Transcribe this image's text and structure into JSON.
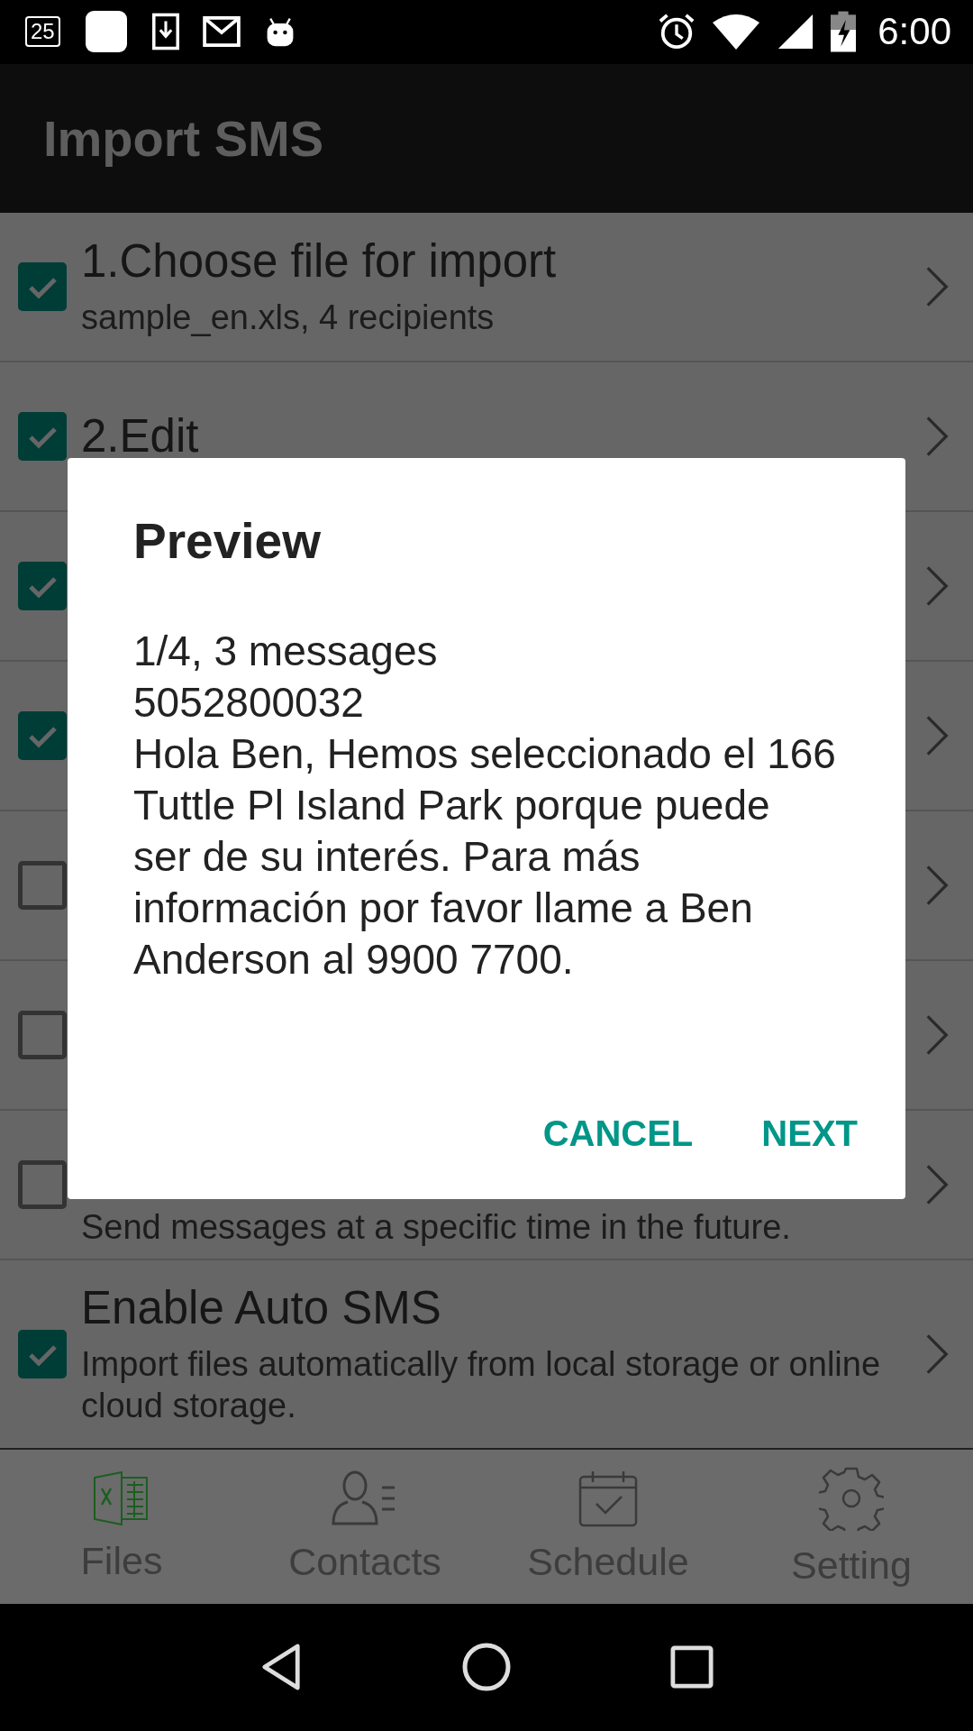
{
  "status_bar": {
    "notification_badge": "25",
    "time": "6:00"
  },
  "app_bar": {
    "title": "Import SMS"
  },
  "steps": [
    {
      "title": "1.Choose file for import",
      "subtitle": "sample_en.xls, 4 recipients",
      "checked": true
    },
    {
      "title": "2.Edit",
      "checked": true
    },
    {
      "checked": true
    },
    {
      "checked": true
    },
    {
      "checked": false
    },
    {
      "checked": false
    },
    {
      "subtitle": "Send messages at a specific time in the future.",
      "checked": false
    },
    {
      "title": "Enable Auto SMS",
      "subtitle": "Import files automatically from local storage or online cloud storage.",
      "checked": true
    }
  ],
  "bottom_nav": [
    {
      "label": "Files",
      "kind": "files",
      "selected": true
    },
    {
      "label": "Contacts",
      "kind": "contacts",
      "selected": false
    },
    {
      "label": "Schedule",
      "kind": "schedule",
      "selected": false
    },
    {
      "label": "Setting",
      "kind": "setting",
      "selected": false
    }
  ],
  "dialog": {
    "title": "Preview",
    "lines": [
      "1/4, 3 messages",
      "5052800032"
    ],
    "message": "Hola Ben, Hemos seleccionado el 166 Tuttle Pl Island Park porque puede ser de su interés. Para más información por favor llame a Ben Anderson al 9900 7700.",
    "buttons": [
      "CANCEL",
      "NEXT"
    ]
  }
}
